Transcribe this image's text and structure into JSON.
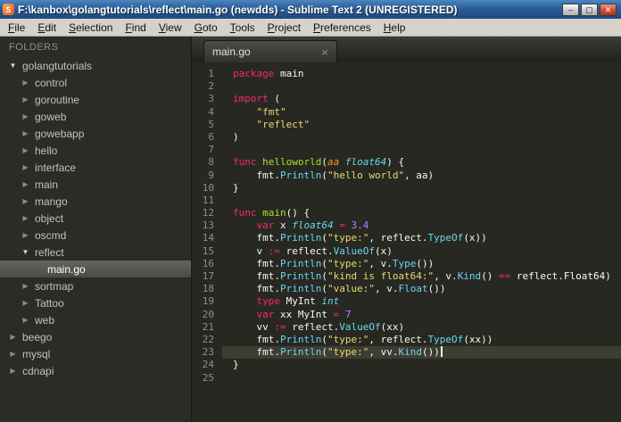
{
  "window": {
    "title": "F:\\kanbox\\golangtutorials\\reflect\\main.go (newdds) - Sublime Text 2 (UNREGISTERED)",
    "app_icon_letter": "S"
  },
  "icons": {
    "minimize": "–",
    "maximize": "▢",
    "close": "✕",
    "tab_close": "×",
    "folder_expanded": "▼",
    "folder_collapsed": "▶"
  },
  "menu": {
    "items": [
      "File",
      "Edit",
      "Selection",
      "Find",
      "View",
      "Goto",
      "Tools",
      "Project",
      "Preferences",
      "Help"
    ]
  },
  "sidebar": {
    "header": "FOLDERS",
    "items": [
      {
        "label": "golangtutorials",
        "level": 0,
        "type": "folder",
        "state": "expanded",
        "selected": false
      },
      {
        "label": "control",
        "level": 1,
        "type": "folder",
        "state": "collapsed",
        "selected": false
      },
      {
        "label": "goroutine",
        "level": 1,
        "type": "folder",
        "state": "collapsed",
        "selected": false
      },
      {
        "label": "goweb",
        "level": 1,
        "type": "folder",
        "state": "collapsed",
        "selected": false
      },
      {
        "label": "gowebapp",
        "level": 1,
        "type": "folder",
        "state": "collapsed",
        "selected": false
      },
      {
        "label": "hello",
        "level": 1,
        "type": "folder",
        "state": "collapsed",
        "selected": false
      },
      {
        "label": "interface",
        "level": 1,
        "type": "folder",
        "state": "collapsed",
        "selected": false
      },
      {
        "label": "main",
        "level": 1,
        "type": "folder",
        "state": "collapsed",
        "selected": false
      },
      {
        "label": "mango",
        "level": 1,
        "type": "folder",
        "state": "collapsed",
        "selected": false
      },
      {
        "label": "object",
        "level": 1,
        "type": "folder",
        "state": "collapsed",
        "selected": false
      },
      {
        "label": "oscmd",
        "level": 1,
        "type": "folder",
        "state": "collapsed",
        "selected": false
      },
      {
        "label": "reflect",
        "level": 1,
        "type": "folder",
        "state": "expanded",
        "selected": false
      },
      {
        "label": "main.go",
        "level": 2,
        "type": "file",
        "state": "file",
        "selected": true
      },
      {
        "label": "sortmap",
        "level": 1,
        "type": "folder",
        "state": "collapsed",
        "selected": false
      },
      {
        "label": "Tattoo",
        "level": 1,
        "type": "folder",
        "state": "collapsed",
        "selected": false
      },
      {
        "label": "web",
        "level": 1,
        "type": "folder",
        "state": "collapsed",
        "selected": false
      },
      {
        "label": "beego",
        "level": 0,
        "type": "folder",
        "state": "collapsed",
        "selected": false
      },
      {
        "label": "mysql",
        "level": 0,
        "type": "folder",
        "state": "collapsed",
        "selected": false
      },
      {
        "label": "cdnapi",
        "level": 0,
        "type": "folder",
        "state": "collapsed",
        "selected": false
      }
    ]
  },
  "tab": {
    "label": "main.go"
  },
  "editor": {
    "current_line": 23,
    "cursor_line": 23,
    "colors": {
      "background": "#272822",
      "keyword": "#f92672",
      "function": "#a6e22e",
      "type": "#66d9ef",
      "string": "#e6db74",
      "number": "#ae81ff",
      "parameter": "#fd971f",
      "plain": "#f8f8f2",
      "line_number": "#8f908a",
      "current_line_bg": "#3e3d32"
    },
    "lines": [
      [
        {
          "t": "kw",
          "s": "package"
        },
        {
          "t": "p",
          "s": " main"
        }
      ],
      [],
      [
        {
          "t": "kw",
          "s": "import"
        },
        {
          "t": "p",
          "s": " ("
        }
      ],
      [
        {
          "t": "p",
          "s": "    "
        },
        {
          "t": "str",
          "s": "\"fmt\""
        }
      ],
      [
        {
          "t": "p",
          "s": "    "
        },
        {
          "t": "str",
          "s": "\"reflect\""
        }
      ],
      [
        {
          "t": "p",
          "s": ")"
        }
      ],
      [],
      [
        {
          "t": "kw",
          "s": "func "
        },
        {
          "t": "fn",
          "s": "helloworld"
        },
        {
          "t": "p",
          "s": "("
        },
        {
          "t": "param",
          "s": "aa"
        },
        {
          "t": "p",
          "s": " "
        },
        {
          "t": "type",
          "s": "float64"
        },
        {
          "t": "p",
          "s": ") {"
        }
      ],
      [
        {
          "t": "p",
          "s": "    fmt."
        },
        {
          "t": "call",
          "s": "Println"
        },
        {
          "t": "p",
          "s": "("
        },
        {
          "t": "str",
          "s": "\"hello world\""
        },
        {
          "t": "p",
          "s": ", aa)"
        }
      ],
      [
        {
          "t": "p",
          "s": "}"
        }
      ],
      [],
      [
        {
          "t": "kw",
          "s": "func "
        },
        {
          "t": "fn",
          "s": "main"
        },
        {
          "t": "p",
          "s": "() {"
        }
      ],
      [
        {
          "t": "p",
          "s": "    "
        },
        {
          "t": "kw",
          "s": "var"
        },
        {
          "t": "p",
          "s": " x "
        },
        {
          "t": "type",
          "s": "float64"
        },
        {
          "t": "p",
          "s": " "
        },
        {
          "t": "op",
          "s": "="
        },
        {
          "t": "p",
          "s": " "
        },
        {
          "t": "num",
          "s": "3.4"
        }
      ],
      [
        {
          "t": "p",
          "s": "    fmt."
        },
        {
          "t": "call",
          "s": "Println"
        },
        {
          "t": "p",
          "s": "("
        },
        {
          "t": "str",
          "s": "\"type:\""
        },
        {
          "t": "p",
          "s": ", reflect."
        },
        {
          "t": "call",
          "s": "TypeOf"
        },
        {
          "t": "p",
          "s": "(x))"
        }
      ],
      [
        {
          "t": "p",
          "s": "    v "
        },
        {
          "t": "op",
          "s": ":="
        },
        {
          "t": "p",
          "s": " reflect."
        },
        {
          "t": "call",
          "s": "ValueOf"
        },
        {
          "t": "p",
          "s": "(x)"
        }
      ],
      [
        {
          "t": "p",
          "s": "    fmt."
        },
        {
          "t": "call",
          "s": "Println"
        },
        {
          "t": "p",
          "s": "("
        },
        {
          "t": "str",
          "s": "\"type:\""
        },
        {
          "t": "p",
          "s": ", v."
        },
        {
          "t": "call",
          "s": "Type"
        },
        {
          "t": "p",
          "s": "())"
        }
      ],
      [
        {
          "t": "p",
          "s": "    fmt."
        },
        {
          "t": "call",
          "s": "Println"
        },
        {
          "t": "p",
          "s": "("
        },
        {
          "t": "str",
          "s": "\"kind is float64:\""
        },
        {
          "t": "p",
          "s": ", v."
        },
        {
          "t": "call",
          "s": "Kind"
        },
        {
          "t": "p",
          "s": "() "
        },
        {
          "t": "op",
          "s": "=="
        },
        {
          "t": "p",
          "s": " reflect.Float64)"
        }
      ],
      [
        {
          "t": "p",
          "s": "    fmt."
        },
        {
          "t": "call",
          "s": "Println"
        },
        {
          "t": "p",
          "s": "("
        },
        {
          "t": "str",
          "s": "\"value:\""
        },
        {
          "t": "p",
          "s": ", v."
        },
        {
          "t": "call",
          "s": "Float"
        },
        {
          "t": "p",
          "s": "())"
        }
      ],
      [
        {
          "t": "p",
          "s": "    "
        },
        {
          "t": "kw",
          "s": "type"
        },
        {
          "t": "p",
          "s": " MyInt "
        },
        {
          "t": "type",
          "s": "int"
        }
      ],
      [
        {
          "t": "p",
          "s": "    "
        },
        {
          "t": "kw",
          "s": "var"
        },
        {
          "t": "p",
          "s": " xx MyInt "
        },
        {
          "t": "op",
          "s": "="
        },
        {
          "t": "p",
          "s": " "
        },
        {
          "t": "num",
          "s": "7"
        }
      ],
      [
        {
          "t": "p",
          "s": "    vv "
        },
        {
          "t": "op",
          "s": ":="
        },
        {
          "t": "p",
          "s": " reflect."
        },
        {
          "t": "call",
          "s": "ValueOf"
        },
        {
          "t": "p",
          "s": "(xx)"
        }
      ],
      [
        {
          "t": "p",
          "s": "    fmt."
        },
        {
          "t": "call",
          "s": "Println"
        },
        {
          "t": "p",
          "s": "("
        },
        {
          "t": "str",
          "s": "\"type:\""
        },
        {
          "t": "p",
          "s": ", reflect."
        },
        {
          "t": "call",
          "s": "TypeOf"
        },
        {
          "t": "p",
          "s": "(xx))"
        }
      ],
      [
        {
          "t": "p",
          "s": "    fmt."
        },
        {
          "t": "call",
          "s": "Println"
        },
        {
          "t": "p",
          "s": "("
        },
        {
          "t": "str",
          "s": "\"type:\""
        },
        {
          "t": "p",
          "s": ", vv."
        },
        {
          "t": "call",
          "s": "Kind"
        },
        {
          "t": "p",
          "s": "())"
        }
      ],
      [
        {
          "t": "p",
          "s": "}"
        }
      ],
      []
    ]
  }
}
